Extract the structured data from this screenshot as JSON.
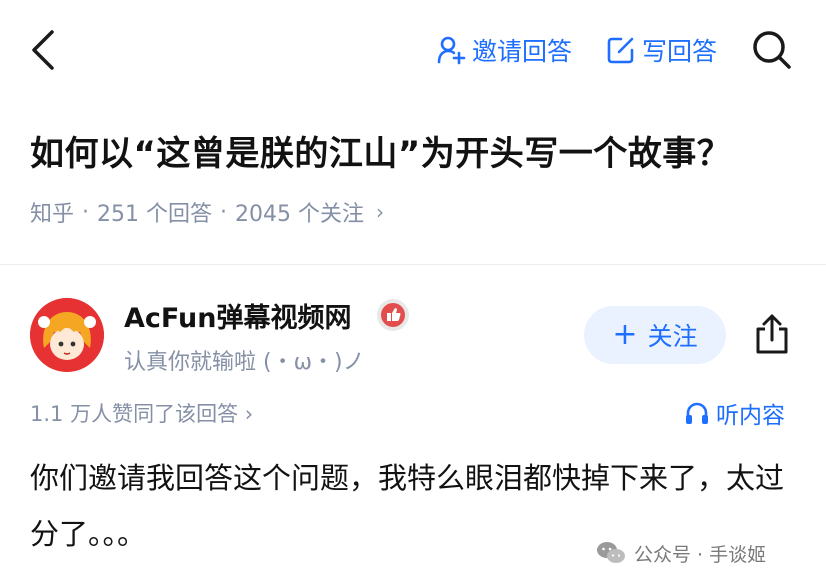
{
  "header": {
    "invite_label": "邀请回答",
    "write_label": "写回答"
  },
  "question": {
    "title": "如何以“这曾是朕的江山”为开头写一个故事？",
    "source": "知乎",
    "answers": "251 个回答",
    "followers": "2045 个关注"
  },
  "answer": {
    "author_name": "AcFun弹幕视频网",
    "author_bio": "认真你就输啦 (・ω・)ノ",
    "follow_label": "关注",
    "likes": "1.1 万人赞同了该回答",
    "listen_label": "听内容",
    "content": "你们邀请我回答这个问题，我特么眼泪都快掉下来了，太过分了。。。"
  },
  "watermark": {
    "text": "公众号 · 手谈姬"
  },
  "colors": {
    "accent": "#1e6fff",
    "meta_gray": "#8590a6",
    "follow_bg": "#eaf2ff"
  }
}
